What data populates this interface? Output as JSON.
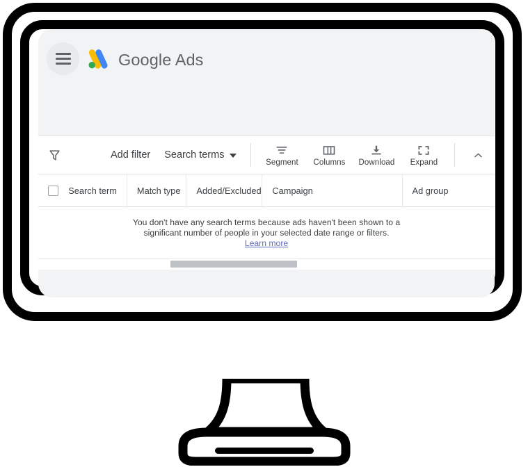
{
  "illustration": {
    "device": "desktop-monitor",
    "frame_color": "#000000",
    "screen_bg": "#f1f3f4"
  },
  "app": {
    "menu_icon": "hamburger-icon",
    "logo_icon": "google-ads-logo",
    "brand_primary": "Google",
    "brand_secondary": "Ads",
    "logo_colors": {
      "blue": "#4285f4",
      "yellow": "#fbbc04",
      "green": "#34a853"
    }
  },
  "toolbar": {
    "filter_icon": "filter-funnel-icon",
    "add_filter_label": "Add filter",
    "view_selector_label": "Search terms",
    "view_selector_icon": "chevron-down-icon",
    "actions": [
      {
        "label": "Segment",
        "icon": "segment-icon"
      },
      {
        "label": "Columns",
        "icon": "columns-icon"
      },
      {
        "label": "Download",
        "icon": "download-icon"
      },
      {
        "label": "Expand",
        "icon": "expand-icon"
      }
    ],
    "collapse_icon": "chevron-up-icon"
  },
  "table": {
    "select_all_checkbox": "unchecked",
    "columns": [
      "Search term",
      "Match type",
      "Added/Excluded",
      "Campaign",
      "Ad group"
    ],
    "rows": [],
    "empty_state": {
      "line1": "You don't have any search terms because ads haven't been shown to a",
      "line2": "significant number of people in your selected date range or filters.",
      "link_label": "Learn more",
      "link_color": "#5f6bbd"
    },
    "horizontal_scrollbar": {
      "thumb_color": "#bdc1c6",
      "position": "partially-scrolled"
    }
  }
}
